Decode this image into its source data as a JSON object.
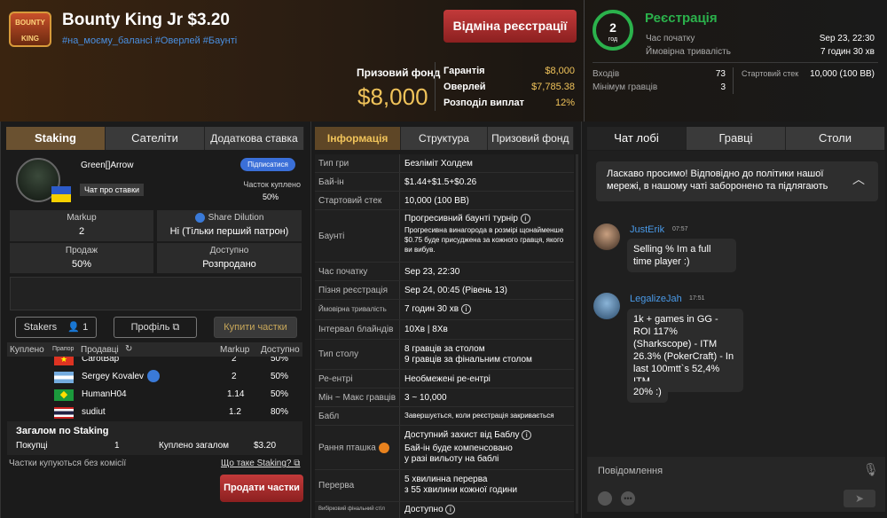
{
  "header": {
    "logo_text": "BOUNTY KING",
    "title": "Bounty King Jr $3.20",
    "tags": "#на_моєму_балансі #Оверлей #Баунті",
    "cancel_btn": "Відміна реєстрації",
    "prize_label": "Призовий фонд",
    "prize_value": "$8,000",
    "guarantee_label": "Гарантія",
    "guarantee_value": "$8,000",
    "overlay_label": "Оверлей",
    "overlay_value": "$7,785.38",
    "payout_label": "Розподіл виплат",
    "payout_value": "12%",
    "timer_value": "2",
    "timer_unit": "год",
    "status": "Реєстрація",
    "start_label": "Час початку",
    "start_value": "Sep 23, 22:30",
    "duration_label": "Ймовірна тривалість",
    "duration_value": "7 годин 30 хв",
    "entries_label": "Входів",
    "entries_value": "73",
    "min_label": "Мінімум гравців",
    "min_value": "3",
    "stack_label": "Стартовий стек",
    "stack_value": "10,000 (100 BB)"
  },
  "staking": {
    "tabs": [
      "Staking",
      "Сателіти",
      "Додаткова ставка"
    ],
    "user": "Green[]Arrow",
    "subscribe": "Підписатися",
    "chat_btn": "Чат про ставки",
    "bought_label": "Часток куплено",
    "bought_value": "50%",
    "markup_label": "Markup",
    "markup_value": "2",
    "share_label": "Share Dilution",
    "share_value": "Ні (Тільки перший патрон)",
    "sale_label": "Продаж",
    "sale_value": "50%",
    "avail_label": "Доступно",
    "avail_value": "Розпродано",
    "stakers_label": "Stakers",
    "stakers_count": "1",
    "profile_btn": "Профіль",
    "buy_btn": "Купити частки",
    "columns": [
      "Куплено",
      "Прапор",
      "Продавці",
      "Markup",
      "Доступно"
    ],
    "rows": [
      {
        "name": "CarotBap",
        "markup": "2",
        "avail": "50%"
      },
      {
        "name": "Sergey Kovalev",
        "markup": "2",
        "avail": "50%"
      },
      {
        "name": "HumanH04",
        "markup": "1.14",
        "avail": "50%"
      },
      {
        "name": "sudiut",
        "markup": "1.2",
        "avail": "80%"
      }
    ],
    "total_title": "Загалом по Staking",
    "purchases_label": "Покупці",
    "purchases_value": "1",
    "total_label": "Куплено загалом",
    "total_value": "$3.20",
    "no_commission": "Частки купуються без комісії",
    "what_is": "Що таке Staking?",
    "sell_btn": "Продати частки"
  },
  "info": {
    "tabs": [
      "Інформація",
      "Структура",
      "Призовий фонд"
    ],
    "rows": [
      {
        "k": "Тип гри",
        "v": "Безліміт Холдем"
      },
      {
        "k": "Бай-ін",
        "v": "$1.44+$1.5+$0.26"
      },
      {
        "k": "Стартовий стек",
        "v": "10,000 (100 BB)"
      },
      {
        "k": "Баунті",
        "v": "Прогресивний баунті турнір",
        "sub": "Прогресивна винагорода в розмірі щонайменше $0.75 буде присуджена за кожного гравця, якого ви вибув."
      },
      {
        "k": "Час початку",
        "v": "Sep 23, 22:30"
      },
      {
        "k": "Пізня реєстрація",
        "v": "Sep 24, 00:45 (Рівень 13)"
      },
      {
        "k": "Ймовірна тривалість",
        "v": "7 годин 30 хв"
      },
      {
        "k": "Інтервал блайндів",
        "v": "10Хв | 8Хв"
      },
      {
        "k": "Тип столу",
        "v": "8 гравців за столом",
        "v2": "9 гравців за фінальним столом"
      },
      {
        "k": "Ре-ентрі",
        "v": "Необмежені ре-ентрі"
      },
      {
        "k": "Мін ~ Макс гравців",
        "v": "3 ~ 10,000"
      },
      {
        "k": "Бабл",
        "v": "Завершується, коли реєстрація закривається"
      },
      {
        "k": "Рання пташка",
        "v": "Доступний захист від Баблу",
        "v2": "Бай-ін буде компенсовано",
        "v3": "у разі вильоту на баблі"
      },
      {
        "k": "Перерва",
        "v": "5 хвилинна перерва",
        "v2": "з 55 хвилини кожної години"
      },
      {
        "k": "Вибірковий фінальний стіл",
        "v": "Доступно"
      }
    ]
  },
  "chat": {
    "tabs": [
      "Чат лобі",
      "Гравці",
      "Столи"
    ],
    "welcome": "Ласкаво просимо! Відповідно до політики нашої мережі, в нашому чаті заборонено та підлягають",
    "messages": [
      {
        "user": "JustErik",
        "time": "07:57",
        "text": "Selling % Im a full time player :)"
      },
      {
        "user": "LegalizeJah",
        "time": "17:51",
        "text": "1k + games in GG - ROI 117% (Sharkscope) - ITM 26.3% (PokerCraft) - In last 100mtt`s 52,4% ITM"
      },
      {
        "user": "",
        "time": "",
        "text": "20% :)"
      }
    ],
    "placeholder": "Повідомлення"
  }
}
